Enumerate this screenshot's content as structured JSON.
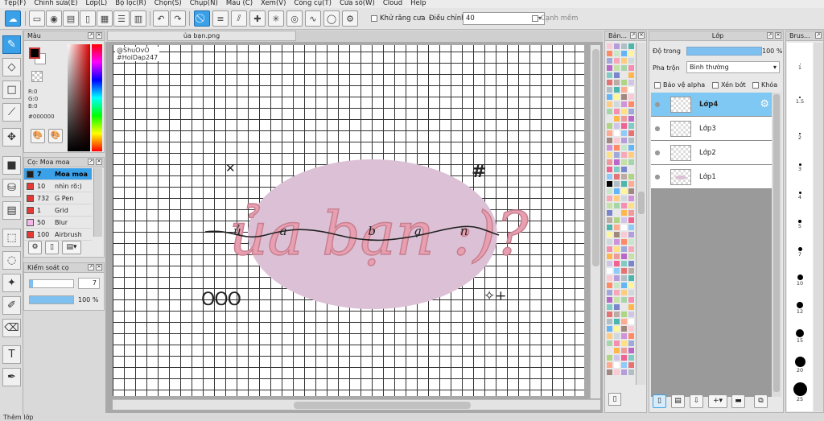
{
  "menu": [
    "Tệp(F)",
    "Chỉnh sửa(E)",
    "Lớp(L)",
    "Bộ lọc(R)",
    "Chọn(S)",
    "Chụp(N)",
    "Màu (C)",
    "Xem(V)",
    "Công cụ(T)",
    "Cửa sổ(W)",
    "Cloud",
    "Help"
  ],
  "toolbar": {
    "antialias_label": "Khử răng cưa",
    "adjust_label": "Điều chỉnh",
    "adjust_value": "40",
    "smooth_label": "Cạnh mềm"
  },
  "color_panel": {
    "title": "Màu",
    "r": "R:0",
    "g": "G:0",
    "b": "B:0",
    "hex": "#000000"
  },
  "brush_panel": {
    "title": "Cọ: Moa moa",
    "items": [
      {
        "size": "7",
        "name": "Moa moa",
        "color": "#1f1f1f"
      },
      {
        "size": "10",
        "name": "nhìn rõ:)",
        "color": "#e53935"
      },
      {
        "size": "732",
        "name": "G Pen",
        "color": "#e53935"
      },
      {
        "size": "1",
        "name": "Grid",
        "color": "#e53935"
      },
      {
        "size": "50",
        "name": "Blur",
        "color": "#f4b6e9"
      },
      {
        "size": "100",
        "name": "Airbrush",
        "color": "#e53935"
      }
    ]
  },
  "brush_control": {
    "title": "Kiểm soát cọ",
    "size": "7",
    "opacity": "100 %"
  },
  "document": {
    "tab": "ủa bạn.png",
    "watermark_1": "@ShuOvO",
    "watermark_2": "#HoiDap247",
    "art_text": "ủa bạn :)?",
    "script_text": "ủa bạn",
    "decor": "OOO",
    "hash": "#"
  },
  "swatch_panel": {
    "title": "Bản..."
  },
  "layer_panel": {
    "title": "Lớp",
    "opacity_label": "Độ trong",
    "opacity_value": "100 %",
    "blend_label": "Pha trộn",
    "blend_value": "Bình thường",
    "opt_alpha": "Bảo vệ alpha",
    "opt_clip": "Xén bớt",
    "opt_lock": "Khóa",
    "layers": [
      "Lớp4",
      "Lớp3",
      "Lớp2",
      "Lớp1"
    ]
  },
  "brush_size_panel": {
    "title": "Brus...",
    "labels": [
      "1",
      "1.5",
      "2",
      "3",
      "4",
      "5",
      "7",
      "10",
      "12",
      "15",
      "20",
      "25"
    ]
  },
  "status_text": "Thêm lớp",
  "colors": {
    "accent": "#3aa0e8",
    "blob": "#dcc1d6",
    "letters": "#e8a0b0"
  }
}
